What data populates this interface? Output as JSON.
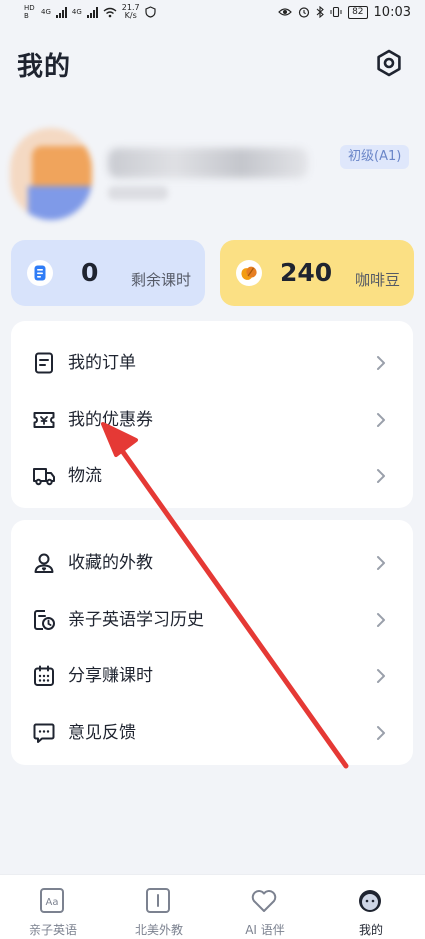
{
  "status_bar": {
    "left_codes": "HD B",
    "network": "4G",
    "speed_value": "21.7",
    "speed_unit": "K/s",
    "battery": "82",
    "time": "10:03"
  },
  "header": {
    "title": "我的"
  },
  "profile": {
    "level_badge": "初级(A1)"
  },
  "stats": [
    {
      "value": "0",
      "label": "剩余课时",
      "icon": "lesson-card-icon",
      "color": "#d8e3fb"
    },
    {
      "value": "240",
      "label": "咖啡豆",
      "icon": "coffee-bean-icon",
      "color": "#fbe084"
    }
  ],
  "menu_group_1": [
    {
      "label": "我的订单",
      "icon": "order-icon"
    },
    {
      "label": "我的优惠券",
      "icon": "coupon-icon"
    },
    {
      "label": "物流",
      "icon": "truck-icon"
    }
  ],
  "menu_group_2": [
    {
      "label": "收藏的外教",
      "icon": "favorite-teacher-icon"
    },
    {
      "label": "亲子英语学习历史",
      "icon": "history-icon"
    },
    {
      "label": "分享赚课时",
      "icon": "calendar-icon"
    },
    {
      "label": "意见反馈",
      "icon": "feedback-icon"
    }
  ],
  "bottom_nav": [
    {
      "label": "亲子英语",
      "icon": "aa-book-icon"
    },
    {
      "label": "北美外教",
      "icon": "book-icon"
    },
    {
      "label": "AI 语伴",
      "icon": "heart-icon"
    },
    {
      "label": "我的",
      "icon": "profile-face-icon",
      "active": true
    }
  ],
  "colors": {
    "accent_red": "#e53935",
    "badge_text": "#6b86c8"
  }
}
